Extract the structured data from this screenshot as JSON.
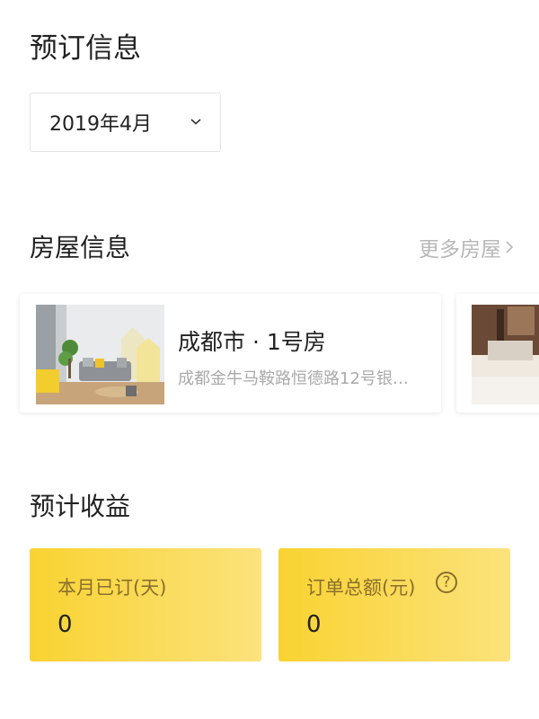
{
  "booking": {
    "title": "预订信息",
    "month_select": {
      "value": "2019年4月",
      "icon": "chevron-down-icon"
    }
  },
  "house": {
    "title": "房屋信息",
    "more_label": "更多房屋",
    "more_icon": "chevron-right-icon",
    "cards": [
      {
        "name": "成都市 · 1号房",
        "address": "成都金牛马鞍路恒德路12号银…"
      }
    ]
  },
  "earnings": {
    "title": "预计收益",
    "stats": [
      {
        "label": "本月已订(天)",
        "value": "0"
      },
      {
        "label": "订单总额(元)",
        "value": "0",
        "help_icon": "?"
      }
    ]
  },
  "colors": {
    "accent_start": "#f9d332",
    "accent_end": "#fbe27c",
    "muted": "#b8b8b8"
  }
}
